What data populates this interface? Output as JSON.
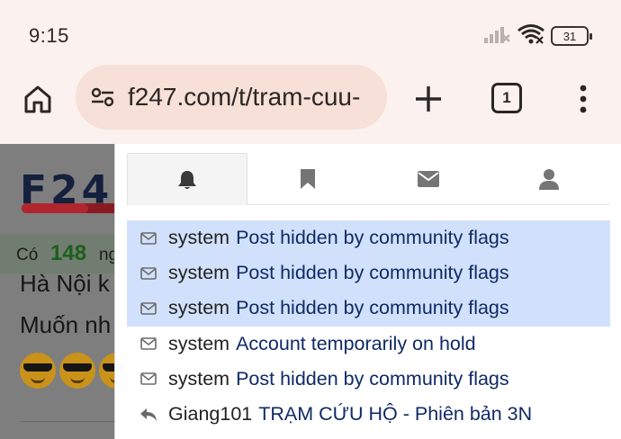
{
  "status_bar": {
    "time": "9:15",
    "battery": "31"
  },
  "browser": {
    "url": "f247.com/t/tram-cuu-",
    "tab_count": "1"
  },
  "background_page": {
    "logo_text": "F24",
    "online_prefix": "Có",
    "online_count": "148",
    "online_suffix": "ng",
    "line1": "Hà Nội k",
    "line2": "Muốn nh"
  },
  "dropdown": {
    "tabs": [
      {
        "icon": "bell-icon",
        "active": true
      },
      {
        "icon": "bookmark-icon",
        "active": false
      },
      {
        "icon": "envelope-icon",
        "active": false
      },
      {
        "icon": "user-icon",
        "active": false
      }
    ],
    "items": [
      {
        "icon": "envelope-icon",
        "user": "system",
        "title": "Post hidden by community flags",
        "unread": true
      },
      {
        "icon": "envelope-icon",
        "user": "system",
        "title": "Post hidden by community flags",
        "unread": true
      },
      {
        "icon": "envelope-icon",
        "user": "system",
        "title": "Post hidden by community flags",
        "unread": true
      },
      {
        "icon": "envelope-icon",
        "user": "system",
        "title": "Account temporarily on hold",
        "unread": false
      },
      {
        "icon": "envelope-icon",
        "user": "system",
        "title": "Post hidden by community flags",
        "unread": false
      },
      {
        "icon": "reply-icon",
        "user": "Giang101",
        "title": "TRẠM CỨU HỘ - Phiên bản 3N",
        "unread": false
      }
    ]
  },
  "colors": {
    "unread_bg": "#d1e1fb",
    "title_text": "#0f2a66",
    "browser_chrome": "#fbf1ee",
    "url_bar": "#f6e0d7"
  }
}
